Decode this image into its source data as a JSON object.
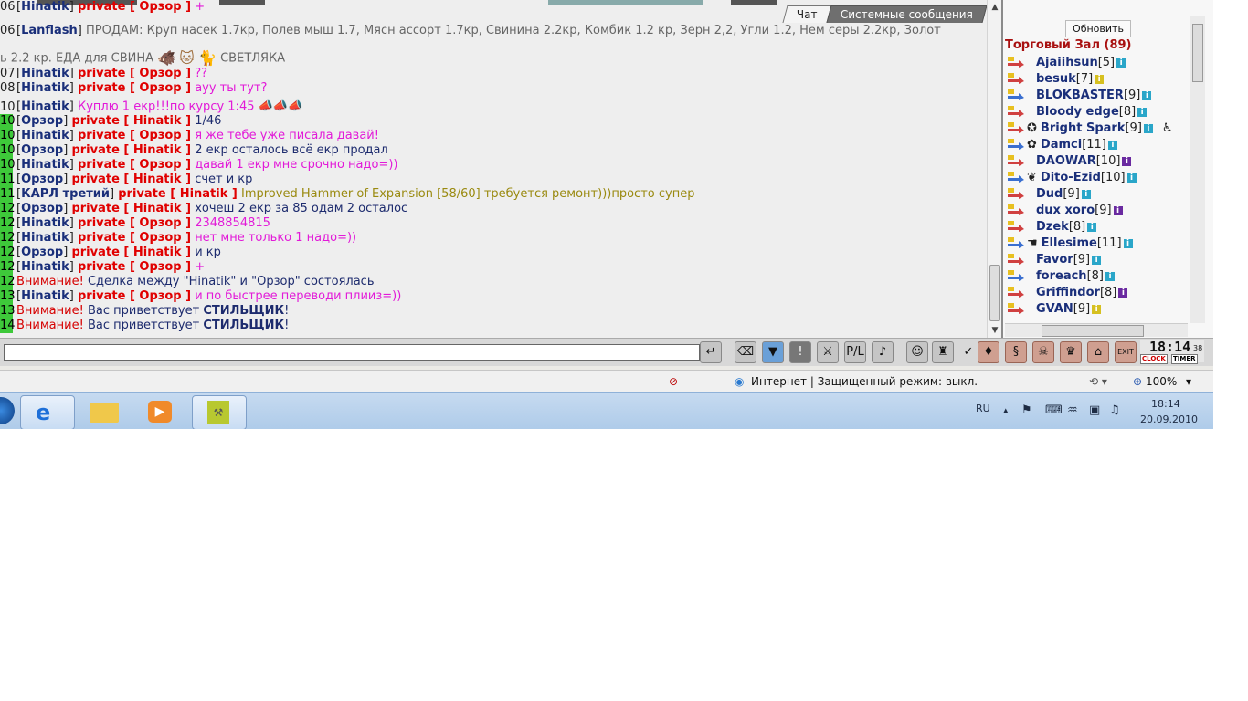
{
  "tabs": {
    "chat": "Чат",
    "system": "Системные сообщения"
  },
  "messages": [
    {
      "time": "06",
      "hl": false,
      "from": "Hinatik",
      "private": "private [ Орзор ]",
      "text": "+",
      "color": "pink"
    },
    {
      "time": "06",
      "hl": false,
      "from": "Lanflash",
      "private": "",
      "text": "ПРОДАМ: Круп насек 1.7кр, Полев мыш 1.7, Мясн ассорт 1.7кр, Свинина 2.2кр, Комбик 1.2 кр, Зерн 2,2, Угли 1.2, Нем серы 2.2кр, Золот",
      "color": "gray"
    },
    {
      "time": "",
      "hl": false,
      "from": "",
      "private": "",
      "text": "ь 2.2 кр. ЕДА для СВИНА",
      "text2": "СВЕТЛЯКА",
      "color": "gray"
    },
    {
      "time": "07",
      "hl": false,
      "from": "Hinatik",
      "private": "private [ Орзор ]",
      "text": "??",
      "color": "pink"
    },
    {
      "time": "08",
      "hl": false,
      "from": "Hinatik",
      "private": "private [ Орзор ]",
      "text": "ауу ты тут?",
      "color": "pink"
    },
    {
      "time": "10",
      "hl": false,
      "from": "Hinatik",
      "private": "",
      "text": "Куплю 1 екр!!!по курсу 1:45",
      "color": "pink"
    },
    {
      "time": "10",
      "hl": true,
      "from": "Орзор",
      "private": "private [ Hinatik ]",
      "text": "1/46",
      "color": "navy"
    },
    {
      "time": "10",
      "hl": true,
      "from": "Hinatik",
      "private": "private [ Орзор ]",
      "text": "я же тебе уже писала давай!",
      "color": "pink"
    },
    {
      "time": "10",
      "hl": true,
      "from": "Орзор",
      "private": "private [ Hinatik ]",
      "text": "2 екр осталось всё екр продал",
      "color": "navy"
    },
    {
      "time": "10",
      "hl": true,
      "from": "Hinatik",
      "private": "private [ Орзор ]",
      "text": "давай 1 екр мне срочно надо=))",
      "color": "pink"
    },
    {
      "time": "11",
      "hl": true,
      "from": "Орзор",
      "private": "private [ Hinatik ]",
      "text": "счет и кр",
      "color": "navy"
    },
    {
      "time": "11",
      "hl": true,
      "from": "КАРЛ третий",
      "private": "private [ Hinatik ]",
      "text": "Improved Hammer of Expansion [58/60] требуется ремонт)))просто супер",
      "color": "olive"
    },
    {
      "time": "12",
      "hl": true,
      "from": "Орзор",
      "private": "private [ Hinatik ]",
      "text": "хочеш 2 екр за 85 одам 2 осталос",
      "color": "navy"
    },
    {
      "time": "12",
      "hl": true,
      "from": "Hinatik",
      "private": "private [ Орзор ]",
      "text": "2348854815",
      "color": "pink"
    },
    {
      "time": "12",
      "hl": true,
      "from": "Hinatik",
      "private": "private [ Орзор ]",
      "text": "нет мне только 1 надо=))",
      "color": "pink"
    },
    {
      "time": "12",
      "hl": true,
      "from": "Орзор",
      "private": "private [ Hinatik ]",
      "text": "и кр",
      "color": "navy"
    },
    {
      "time": "12",
      "hl": true,
      "from": "Hinatik",
      "private": "private [ Орзор ]",
      "text": "+",
      "color": "pink"
    },
    {
      "time": "12",
      "hl": true,
      "from": "",
      "private": "",
      "system": "Внимание!",
      "text": "Сделка между \"Hinatik\" и \"Орзор\" состоялась",
      "color": "navy"
    },
    {
      "time": "13",
      "hl": true,
      "from": "Hinatik",
      "private": "private [ Орзор ]",
      "text": "и по быстрее переводи плииз=))",
      "color": "pink"
    },
    {
      "time": "13",
      "hl": true,
      "from": "",
      "private": "",
      "system": "Внимание!",
      "text": "Вас приветствует",
      "bold": "СТИЛЬЩИК",
      "tail": "!",
      "color": "navy"
    },
    {
      "time": "14",
      "hl": true,
      "from": "",
      "private": "",
      "system": "Внимание!",
      "text": "Вас приветствует",
      "bold": "СТИЛЬЩИК",
      "tail": "!",
      "color": "navy"
    }
  ],
  "sidebar": {
    "refresh": "Обновить",
    "hall": "Торговый Зал (89)",
    "users": [
      {
        "name": "Ajaiihsun",
        "level": "[5]",
        "badge": "#2aa6c9",
        "arrow": "#d04040"
      },
      {
        "name": "besuk",
        "level": "[7]",
        "badge": "#d6c020",
        "arrow": "#d04040"
      },
      {
        "name": "BLOKBASTER",
        "level": "[9]",
        "badge": "#2aa6c9",
        "arrow": "#3a6fd0"
      },
      {
        "name": "Bloody edge",
        "level": "[8]",
        "badge": "#2aa6c9",
        "arrow": "#d04040"
      },
      {
        "name": "Bright Spark",
        "level": "[9]",
        "badge": "#2aa6c9",
        "arrow": "#d04040",
        "pre": "✪",
        "post": "♿"
      },
      {
        "name": "Damci",
        "level": "[11]",
        "badge": "#2aa6c9",
        "arrow": "#3a6fd0",
        "pre": "✿"
      },
      {
        "name": "DAOWAR",
        "level": "[10]",
        "badge": "#6a2aa0",
        "arrow": "#d04040"
      },
      {
        "name": "Dito-Ezid",
        "level": "[10]",
        "badge": "#2aa6c9",
        "arrow": "#3a6fd0",
        "pre": "❦"
      },
      {
        "name": "Dud",
        "level": "[9]",
        "badge": "#2aa6c9",
        "arrow": "#d04040"
      },
      {
        "name": "dux xoro",
        "level": "[9]",
        "badge": "#6a2aa0",
        "arrow": "#d04040"
      },
      {
        "name": "Dzek",
        "level": "[8]",
        "badge": "#2aa6c9",
        "arrow": "#d04040"
      },
      {
        "name": "Ellesime",
        "level": "[11]",
        "badge": "#2aa6c9",
        "arrow": "#3a6fd0",
        "pre": "☚"
      },
      {
        "name": "Favor",
        "level": "[9]",
        "badge": "#2aa6c9",
        "arrow": "#d04040"
      },
      {
        "name": "foreach",
        "level": "[8]",
        "badge": "#2aa6c9",
        "arrow": "#3a6fd0"
      },
      {
        "name": "Griffindor",
        "level": "[8]",
        "badge": "#6a2aa0",
        "arrow": "#d04040"
      },
      {
        "name": "GVAN",
        "level": "[9]",
        "badge": "#d6c020",
        "arrow": "#d04040"
      }
    ]
  },
  "toolbar": {
    "clock_time": "18:14",
    "clock_seconds": "38",
    "clock_label": "CLOCK",
    "timer_label": "TIMER",
    "exit_label": "EXIT"
  },
  "status": {
    "zone": "Интернет | Защищенный режим: выкл.",
    "zoom": "100%"
  },
  "taskbar": {
    "lang": "RU",
    "time": "18:14",
    "date": "20.09.2010"
  }
}
